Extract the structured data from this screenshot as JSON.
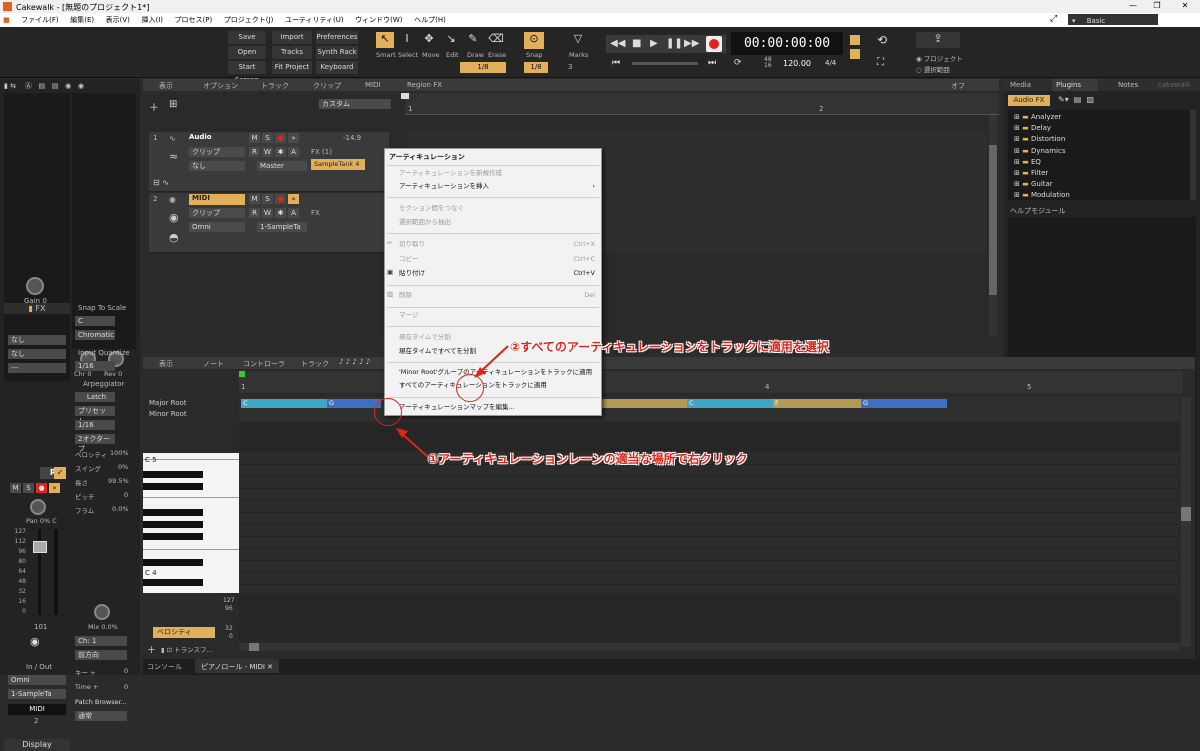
{
  "window": {
    "title": "Cakewalk - [無題のプロジェクト1*]",
    "minimize": "—",
    "maximize": "❐",
    "close": "✕",
    "layout_name": "Basic"
  },
  "menu": [
    "ファイル(F)",
    "編集(E)",
    "表示(V)",
    "挿入(I)",
    "プロセス(P)",
    "プロジェクト(J)",
    "ユーティリティ(U)",
    "ウィンドウ(W)",
    "ヘルプ(H)"
  ],
  "toolbar": {
    "buttons": [
      "Save",
      "Import",
      "Preferences",
      "Open",
      "Tracks",
      "Synth Rack",
      "Start Screen",
      "Fit Project",
      "Keyboard"
    ],
    "snap_value": "1/8",
    "tools": [
      "Smart",
      "Select",
      "Move",
      "Edit",
      "Draw",
      "Erase"
    ],
    "snap_label": "Snap",
    "snap_res": "1/8",
    "marks_label": "Marks",
    "marks_val": "3",
    "time": "00:00:00:00",
    "sig_top": "48",
    "sig_bot": "16",
    "tempo": "120.00",
    "meter": "4/4",
    "scope_project": "プロジェクト",
    "scope_selection": "選択範囲"
  },
  "track_view": {
    "menus": [
      "表示",
      "オプション",
      "トラック",
      "クリップ",
      "MIDI",
      "Region FX"
    ],
    "menu_right": "オフ",
    "preset": "カスタム",
    "ruler_1": "1",
    "ruler_2": "2",
    "track1": {
      "num": "1",
      "name": "Audio",
      "value": "-14.9",
      "clip_label": "クリップ",
      "input": "なし",
      "output": "Master",
      "fx": "FX (1)",
      "plugin": "SampleTank 4"
    },
    "track2": {
      "num": "2",
      "name": "MIDI",
      "clip_label": "クリップ",
      "input": "Omni",
      "output": "1-SampleTa",
      "fx": "FX"
    }
  },
  "inspector": {
    "gain_label": "Gain",
    "gain_val": "0",
    "chr_label": "Chr",
    "chr_val": "0",
    "rev_label": "Rev",
    "rev_val": "0",
    "fx": "FX",
    "none1": "なし",
    "none2": "なし",
    "dash": "---",
    "snap_scale": "Snap To Scale",
    "key": "C",
    "scale": "Chromatic",
    "input_quantize": "Input Quantize",
    "iq": "1/16",
    "arpeggiator": "Arpeggiator",
    "latch": "Latch",
    "preset": "プリセット...",
    "arp_res": "1/16",
    "octave": "2オクターブ",
    "velocity_label": "ベロシティ",
    "velocity": "100%",
    "swing_label": "スイング",
    "swing": "0%",
    "length_label": "長さ",
    "length": "99.5%",
    "pitch_label": "ピッチ",
    "pitch": "0",
    "flam_label": "フラム",
    "flam": "0.0%",
    "mix_label": "Mix",
    "mix": "0.0%",
    "ch": "Ch: 1",
    "direction": "前方向",
    "key_plus": "キー +",
    "key_plus_val": "0",
    "time_plus": "Time +",
    "time_plus_val": "0",
    "patch_browser": "Patch Browser...",
    "normal": "通常",
    "pan": "Pan",
    "pan_val": "0% C",
    "fader_marks": [
      "127",
      "112",
      "96",
      "80",
      "64",
      "48",
      "32",
      "16",
      "0"
    ],
    "volume": "101",
    "inout": "In / Out",
    "in": "Omni",
    "out": "1-SampleTa",
    "track_name": "MIDI",
    "track_num": "2",
    "display": "Display"
  },
  "browser": {
    "tabs": [
      "Media",
      "Plugins",
      "Notes"
    ],
    "brand": "cakewalk",
    "audio_fx": "Audio FX",
    "items": [
      "Analyzer",
      "Delay",
      "Distortion",
      "Dynamics",
      "EQ",
      "Filter",
      "Guitar",
      "Modulation"
    ],
    "help": "ヘルプモジュール"
  },
  "piano_roll": {
    "menus": [
      "表示",
      "ノート",
      "コントローラ",
      "トラック"
    ],
    "ruler": [
      "1",
      "2",
      "3",
      "4",
      "5"
    ],
    "articulations": [
      "Major Root",
      "Minor Root"
    ],
    "chips": [
      {
        "label": "C",
        "color": "#3fa7c6"
      },
      {
        "label": "G",
        "color": "#3f6fc0"
      },
      {
        "label": "C",
        "color": "#3fa7c6"
      },
      {
        "label": "F",
        "color": "#b59a55"
      },
      {
        "label": "G",
        "color": "#3f6fc0"
      }
    ],
    "c5": "C 5",
    "c4": "C 4",
    "velocity_btn": "ベロシティ",
    "transform": "トランスフ...",
    "ctrl_scale": [
      "127",
      "96",
      "32",
      "0"
    ]
  },
  "tabs_bottom": [
    "コンソール",
    "ピアノロール - MIDI"
  ],
  "context_menu": {
    "title": "アーティキュレーション",
    "items": [
      {
        "label": "アーティキュレーションを新規作成",
        "disabled": true,
        "shortcut": ""
      },
      {
        "label": "アーティキュレーションを挿入",
        "disabled": false,
        "shortcut": "›"
      },
      {
        "label": "セクション間をつなぐ",
        "disabled": true,
        "shortcut": ""
      },
      {
        "label": "選択範囲から抽出",
        "disabled": true,
        "shortcut": ""
      },
      {
        "label": "切り取り",
        "disabled": true,
        "shortcut": "Ctrl+X"
      },
      {
        "label": "コピー",
        "disabled": true,
        "shortcut": "Ctrl+C"
      },
      {
        "label": "貼り付け",
        "disabled": false,
        "shortcut": "Ctrl+V"
      },
      {
        "label": "削除",
        "disabled": true,
        "shortcut": "Del"
      },
      {
        "label": "マージ",
        "disabled": true,
        "shortcut": ""
      },
      {
        "label": "現在タイムで分割",
        "disabled": true,
        "shortcut": ""
      },
      {
        "label": "現在タイムですべてを分割",
        "disabled": false,
        "shortcut": ""
      },
      {
        "label": "'Minor Root'グループのアーティキュレーションをトラックに適用",
        "disabled": false,
        "shortcut": ""
      },
      {
        "label": "すべてのアーティキュレーションをトラックに適用",
        "disabled": false,
        "shortcut": ""
      },
      {
        "label": "アーティキュレーションマップを編集...",
        "disabled": false,
        "shortcut": ""
      }
    ]
  },
  "annotations": {
    "step1": "①アーティキュレーションレーンの適当な場所で右クリック",
    "step2": "②すべてのアーティキュレーションをトラックに適用を選択"
  }
}
